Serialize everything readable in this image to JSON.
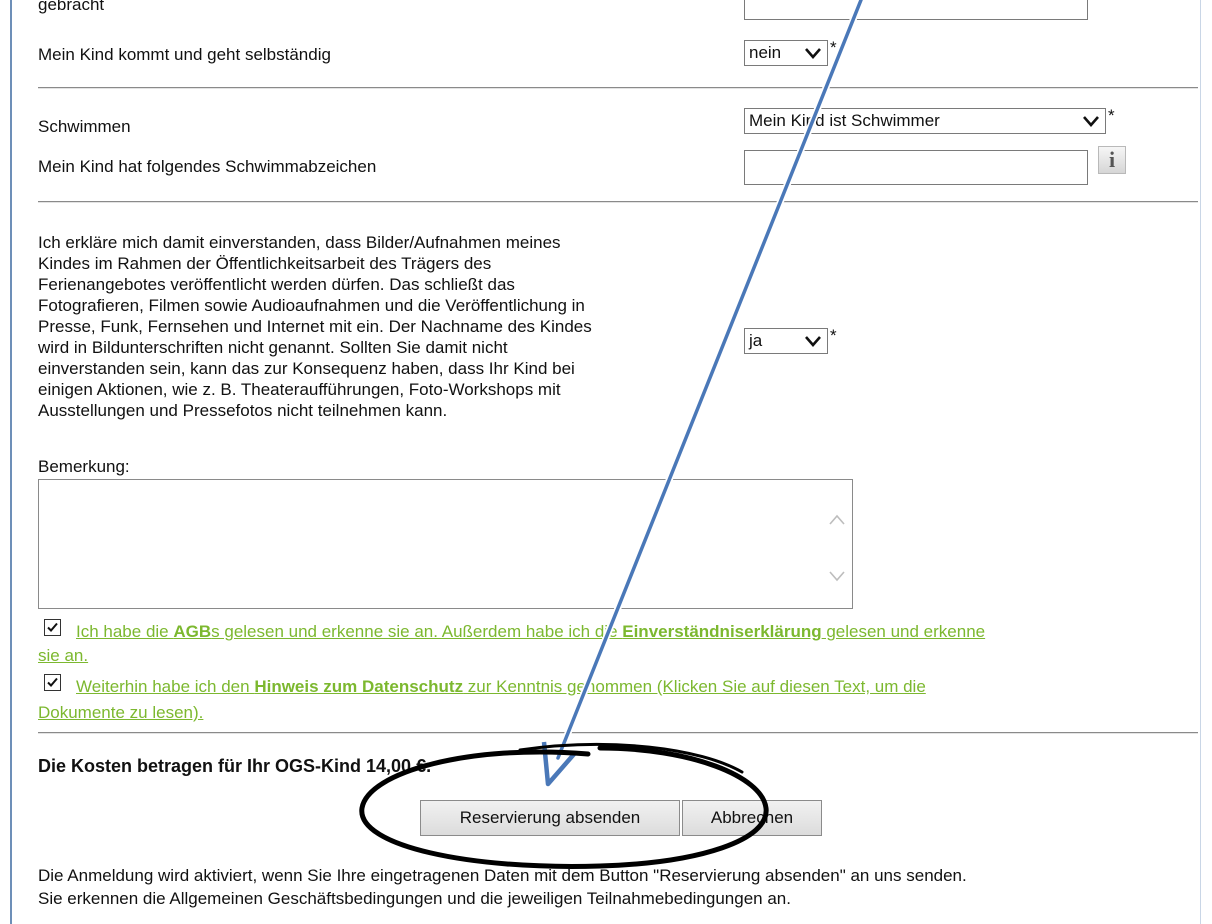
{
  "form": {
    "cutoff_label": "gebracht",
    "independent_label": "Mein Kind kommt und geht selbständig",
    "independent_value": "nein",
    "required_mark": "*",
    "swim_label": "Schwimmen",
    "swim_value": "Mein Kind ist Schwimmer",
    "badge_label": "Mein Kind hat folgendes Schwimmabzeichen",
    "badge_value": "",
    "info_glyph": "i",
    "consent_lines": [
      "Ich erkläre mich damit einverstanden, dass Bilder/Aufnahmen meines",
      "Kindes im Rahmen der Öffentlichkeitsarbeit des Trägers des",
      "Ferienangebotes veröffentlicht werden dürfen. Das schließt das",
      "Fotografieren, Filmen sowie Audioaufnahmen und die Veröffentlichung in",
      "Presse, Funk, Fernsehen und Internet mit ein. Der Nachname des Kindes",
      "wird in Bildunterschriften nicht genannt. Sollten Sie damit nicht",
      "einverstanden sein, kann das zur Konsequenz haben, dass Ihr Kind bei",
      "einigen Aktionen, wie z. B. Theateraufführungen, Foto-Workshops mit",
      "Ausstellungen und Pressefotos nicht teilnehmen kann."
    ],
    "consent_value": "ja",
    "remark_label": "Bemerkung:",
    "remark_value": ""
  },
  "agreements": {
    "agb": {
      "checked": true,
      "part1": "Ich habe die ",
      "bold1": "AGB",
      "part2": "s gelesen und erkenne sie an. Außerdem habe ich die ",
      "bold2": "Einverständniserklärung",
      "part3": " gelesen und erkenne",
      "line2": "sie an."
    },
    "privacy": {
      "checked": true,
      "part1": "Weiterhin habe ich den ",
      "bold1": "Hinweis zum Datenschutz",
      "part2": " zur Kenntnis genommen (Klicken Sie auf diesen Text, um die",
      "line2": "Dokumente zu lesen)."
    }
  },
  "cost_text": "Die Kosten betragen für Ihr OGS-Kind 14,00 €.",
  "buttons": {
    "submit": "Reservierung absenden",
    "cancel": "Abbrechen"
  },
  "footer": {
    "line1": "Die Anmeldung wird aktiviert, wenn Sie Ihre eingetragenen Daten mit dem Button \"Reservierung absenden\" an uns senden.",
    "line2": "Sie erkennen die Allgemeinen Geschäftsbedingungen und die jeweiligen Teilnahmebedingungen an."
  },
  "colors": {
    "link_green": "#7cb82f",
    "annotation_arrow": "#4a78b8",
    "annotation_ellipse": "#000000"
  }
}
